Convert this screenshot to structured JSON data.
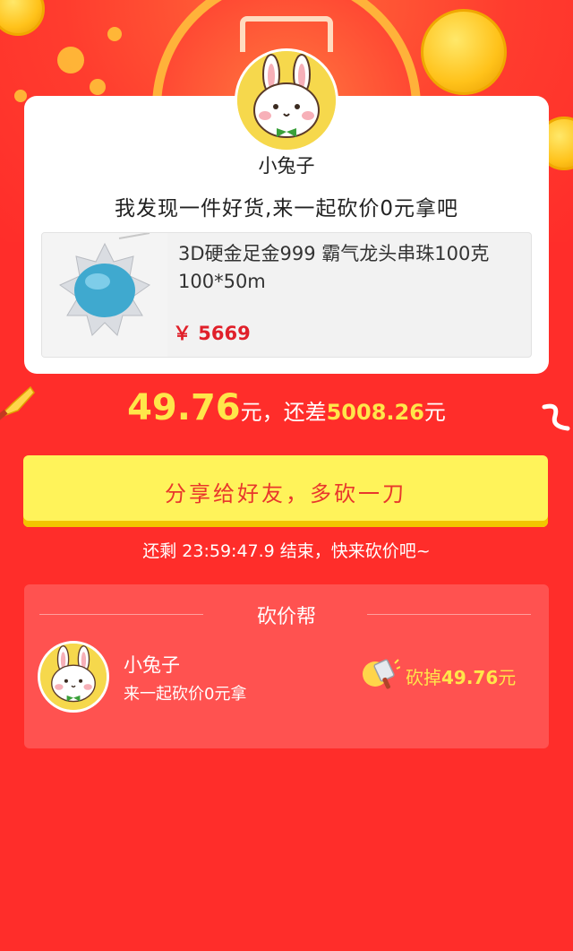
{
  "user": {
    "name": "小兔子"
  },
  "invite": {
    "text": "我发现一件好货,来一起砍价0元拿吧"
  },
  "product": {
    "name": "3D硬金足金999 霸气龙头串珠100克 100*50m",
    "price": "￥ 5669"
  },
  "progress": {
    "amount": "49.76",
    "unit1": "元",
    "mid": "，还差",
    "remaining": "5008.26",
    "unit2": "元"
  },
  "share": {
    "label": "分享给好友，多砍一刀"
  },
  "countdown": {
    "text": "还剩 23:59:47.9 结束，快来砍价吧~"
  },
  "helpers": {
    "title": "砍价帮",
    "items": [
      {
        "name": "小兔子",
        "message": "来一起砍价0元拿",
        "cut_prefix": "砍掉",
        "cut_amount": "49.76",
        "cut_unit": "元"
      }
    ]
  },
  "colors": {
    "background": "#ff2d2a",
    "accent_yellow": "#ffe64a",
    "button": "#fff35a",
    "button_text": "#e8372c",
    "price": "#e0202a"
  },
  "icons": [
    "rabbit-avatar-icon",
    "cleaver-icon",
    "gem-product-image"
  ]
}
